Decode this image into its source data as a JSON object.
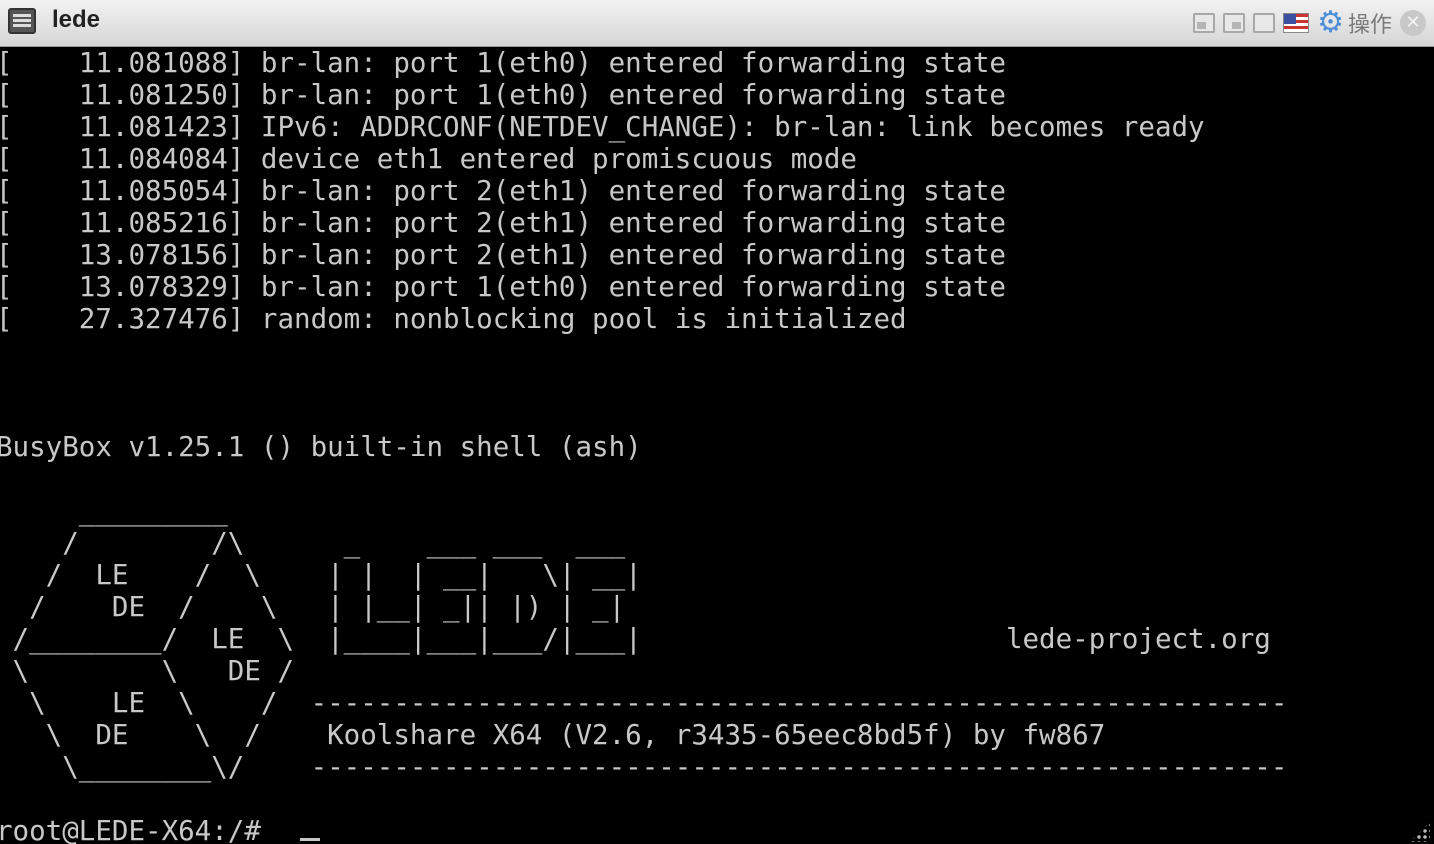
{
  "window": {
    "title": "lede",
    "action_label": "操作",
    "icons": [
      "app-icon",
      "restore-left-icon",
      "restore-right-icon",
      "maximize-icon",
      "us-flag-icon",
      "gear-icon",
      "close-icon"
    ]
  },
  "terminal": {
    "lines": [
      "[    11.081088] br-lan: port 1(eth0) entered forwarding state",
      "[    11.081250] br-lan: port 1(eth0) entered forwarding state",
      "[    11.081423] IPv6: ADDRCONF(NETDEV_CHANGE): br-lan: link becomes ready",
      "[    11.084084] device eth1 entered promiscuous mode",
      "[    11.085054] br-lan: port 2(eth1) entered forwarding state",
      "[    11.085216] br-lan: port 2(eth1) entered forwarding state",
      "[    13.078156] br-lan: port 2(eth1) entered forwarding state",
      "[    13.078329] br-lan: port 1(eth0) entered forwarding state",
      "[    27.327476] random: nonblocking pool is initialized",
      "",
      "",
      "",
      "BusyBox v1.25.1 () built-in shell (ash)",
      "",
      "     _________",
      "    /        /\\      _    ___ ___  ___",
      "   /  LE    /  \\    | |  | __|   \\| __|",
      "  /    DE  /    \\   | |__| _|| |) | _|",
      " /________/  LE  \\  |____|___|___/|___|                      lede-project.org",
      " \\        \\   DE /",
      "  \\    LE  \\    /  -----------------------------------------------------------",
      "   \\  DE    \\  /    Koolshare X64 (V2.6, r3435-65eec8bd5f) by fw867",
      "    \\________\\/    -----------------------------------------------------------",
      "",
      "root@LEDE-X64:/# "
    ]
  }
}
